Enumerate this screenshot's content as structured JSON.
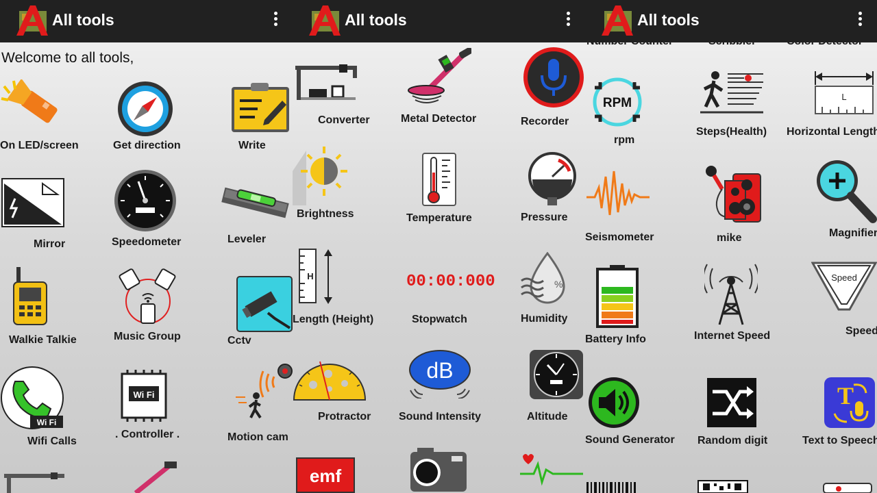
{
  "app": {
    "title": "All tools",
    "welcome": "Welcome to all tools,"
  },
  "panels": {
    "p1": {
      "tools": [
        {
          "label": "On LED/screen"
        },
        {
          "label": "Get direction"
        },
        {
          "label": "Write"
        },
        {
          "label": "Mirror"
        },
        {
          "label": "Speedometer"
        },
        {
          "label": "Leveler"
        },
        {
          "label": "Walkie Talkie"
        },
        {
          "label": "Music Group"
        },
        {
          "label": "Cctv"
        },
        {
          "label": "Wifi Calls"
        },
        {
          "label": ". Controller ."
        },
        {
          "label": "Motion cam"
        }
      ]
    },
    "p2": {
      "tools": [
        {
          "label": "Converter"
        },
        {
          "label": "Metal Detector"
        },
        {
          "label": "Recorder"
        },
        {
          "label": "Brightness"
        },
        {
          "label": "Temperature"
        },
        {
          "label": "Pressure"
        },
        {
          "label": "Length (Height)"
        },
        {
          "label": "Stopwatch"
        },
        {
          "label": "Humidity"
        },
        {
          "label": "Protractor"
        },
        {
          "label": "Sound Intensity"
        },
        {
          "label": "Altitude"
        }
      ],
      "stopwatch_display": "00:00:000",
      "db_text": "dB",
      "emf_text": "emf",
      "length_letter": "H",
      "humidity_symbol": "%"
    },
    "p3": {
      "cut_labels": [
        "Number Counter",
        "Scribbler",
        "Color Detector"
      ],
      "tools": [
        {
          "label": "rpm"
        },
        {
          "label": "Steps(Health)"
        },
        {
          "label": "Horizontal Length"
        },
        {
          "label": "Seismometer"
        },
        {
          "label": "mike"
        },
        {
          "label": "Magnifier"
        },
        {
          "label": "Battery Info"
        },
        {
          "label": "Internet Speed"
        },
        {
          "label": "Speed"
        },
        {
          "label": "Sound Generator"
        },
        {
          "label": "Random digit"
        },
        {
          "label": "Text to Speech"
        }
      ],
      "rpm_text": "RPM",
      "speed_text": "Speed",
      "ruler_letter": "L",
      "wifi_chip_text": "Wi Fi",
      "wifi_call_text": "Wi Fi"
    }
  },
  "colors": {
    "appbar": "#212121",
    "logo_red": "#e01b1b",
    "accent_blue": "#1e5bd6",
    "accent_green": "#2db81f"
  }
}
